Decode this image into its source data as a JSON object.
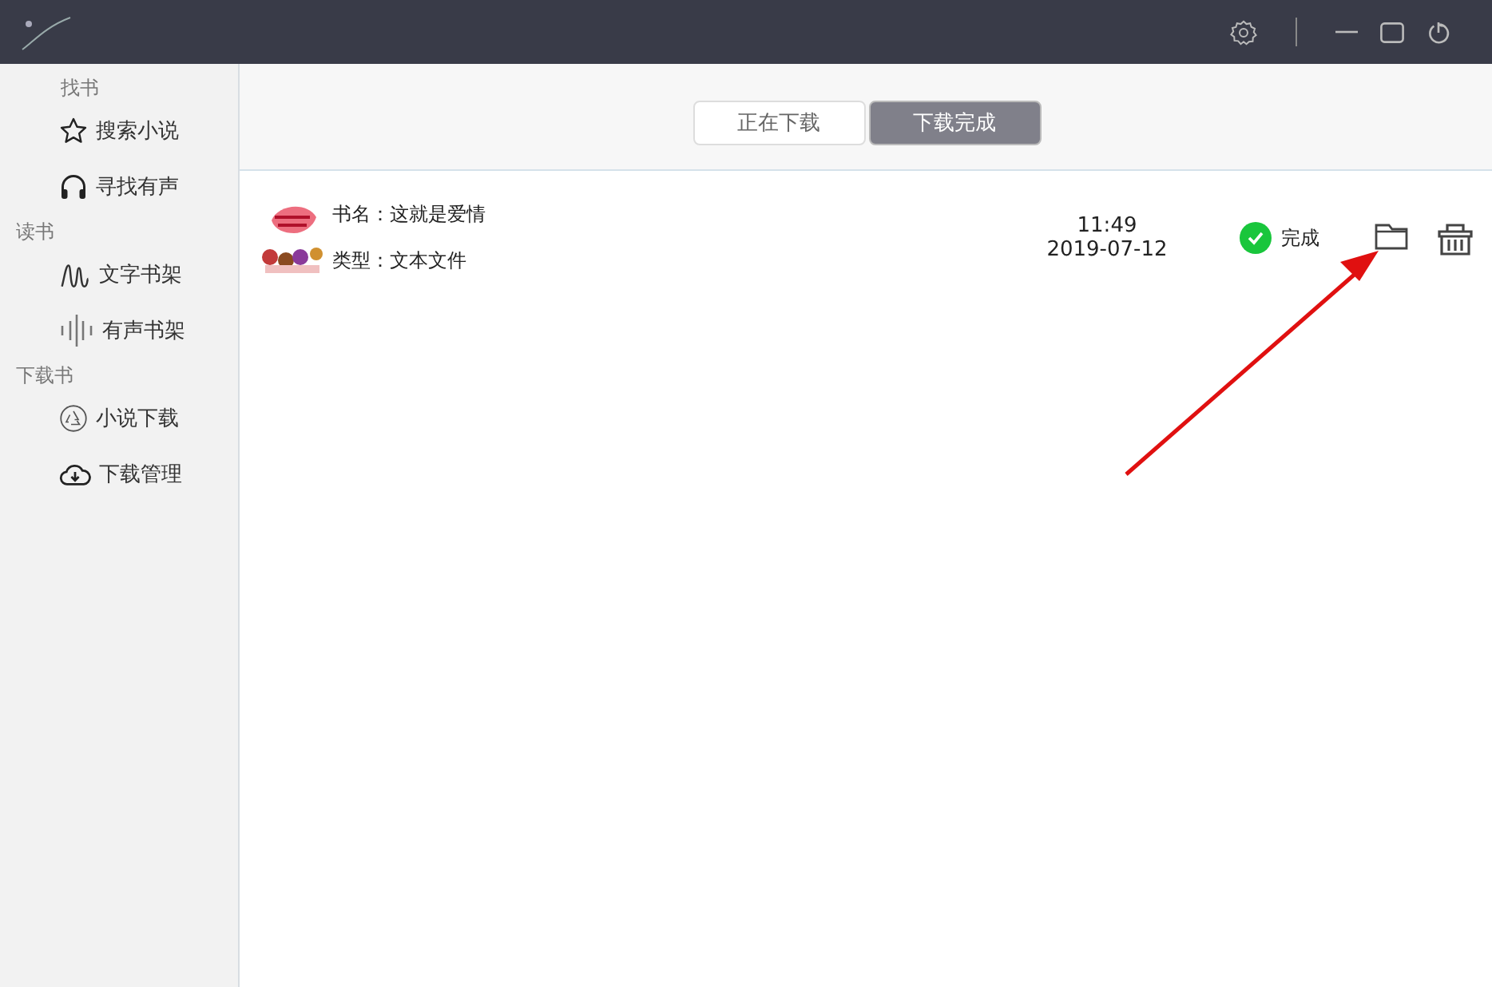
{
  "sidebar": {
    "sections": [
      {
        "title": "找书",
        "items": [
          {
            "label": "搜索小说",
            "kind": "star"
          },
          {
            "label": "寻找有声",
            "kind": "headphones"
          }
        ]
      },
      {
        "title": "读书",
        "items": [
          {
            "label": "文字书架",
            "kind": "text-shelf"
          },
          {
            "label": "有声书架",
            "kind": "audio-shelf"
          }
        ]
      },
      {
        "title": "下载书",
        "items": [
          {
            "label": "小说下载",
            "kind": "recycle"
          },
          {
            "label": "下载管理",
            "kind": "cloud-download"
          }
        ]
      }
    ]
  },
  "tabs": [
    {
      "label": "正在下载",
      "selected": false
    },
    {
      "label": "下载完成",
      "selected": true
    }
  ],
  "downloads": [
    {
      "name": "书名：这就是爱情",
      "type": "类型：文本文件",
      "time": "11:49",
      "date": "2019-07-12",
      "status": "完成",
      "done": true
    }
  ]
}
